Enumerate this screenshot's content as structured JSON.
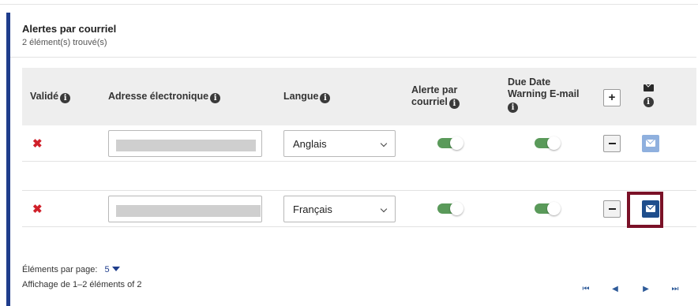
{
  "panel": {
    "title": "Alertes par courriel",
    "count": "2 élément(s) trouvé(s)"
  },
  "table": {
    "headers": {
      "validated": "Validé",
      "email": "Adresse électronique",
      "language": "Langue",
      "email_alert_line1": "Alerte par",
      "email_alert_line2": "courriel",
      "due_date_line1": "Due Date",
      "due_date_line2": "Warning E-mail"
    },
    "rows": [
      {
        "validated": false,
        "language": "Anglais",
        "email_alert": true,
        "due_date_warning": true,
        "send_enabled": false
      },
      {
        "validated": false,
        "language": "Français",
        "email_alert": true,
        "due_date_warning": true,
        "send_enabled": true
      }
    ]
  },
  "pager": {
    "per_page_label": "Éléments par page:",
    "per_page_value": "5",
    "display_text": "Affichage de 1–2 éléments of 2"
  },
  "icons": {
    "info": "info-icon",
    "not_validated": "x-mark-icon",
    "envelope": "envelope-icon",
    "add": "plus-icon",
    "remove": "minus-icon",
    "first": "first-page-icon",
    "prev": "prev-page-icon",
    "next": "next-page-icon",
    "last": "last-page-icon"
  },
  "colors": {
    "accent": "#1f3d8c",
    "invalid": "#d0202a",
    "toggle_on": "#5a9a5a",
    "mail_active": "#1f4e8c",
    "mail_disabled": "#8fb0de",
    "highlight": "#7a1127"
  }
}
